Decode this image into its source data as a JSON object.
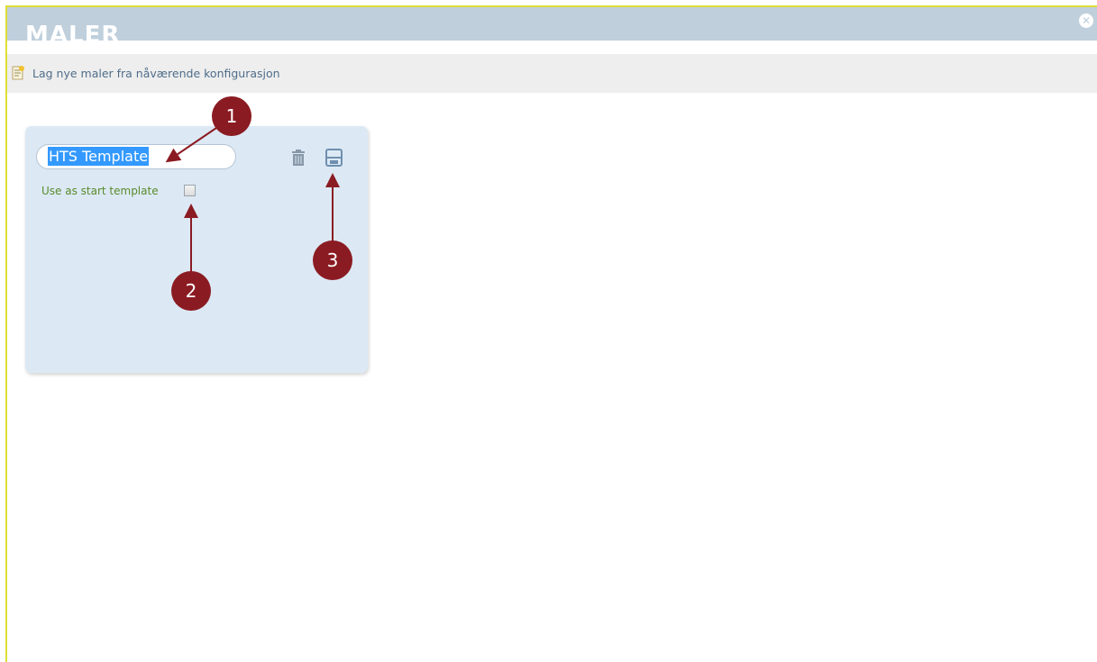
{
  "window": {
    "title": "MALER"
  },
  "toolbar": {
    "new_template_label": "Lag nye maler fra nåværende konfigurasjon"
  },
  "template_card": {
    "name_value": "HTS Template",
    "start_template_label": "Use as start template",
    "start_template_checked": false
  },
  "callouts": [
    "1",
    "2",
    "3"
  ],
  "icons": {
    "close": "close-icon",
    "new_template": "new-template-icon",
    "delete": "trash-icon",
    "save": "save-icon"
  },
  "colors": {
    "titlebar": "#bfcfdc",
    "toolbar": "#eeeeee",
    "card": "#dce9f5",
    "link": "#4f6d8a",
    "label_green": "#5a8a2a",
    "callout": "#8b1b22",
    "selection": "#3399ff"
  }
}
